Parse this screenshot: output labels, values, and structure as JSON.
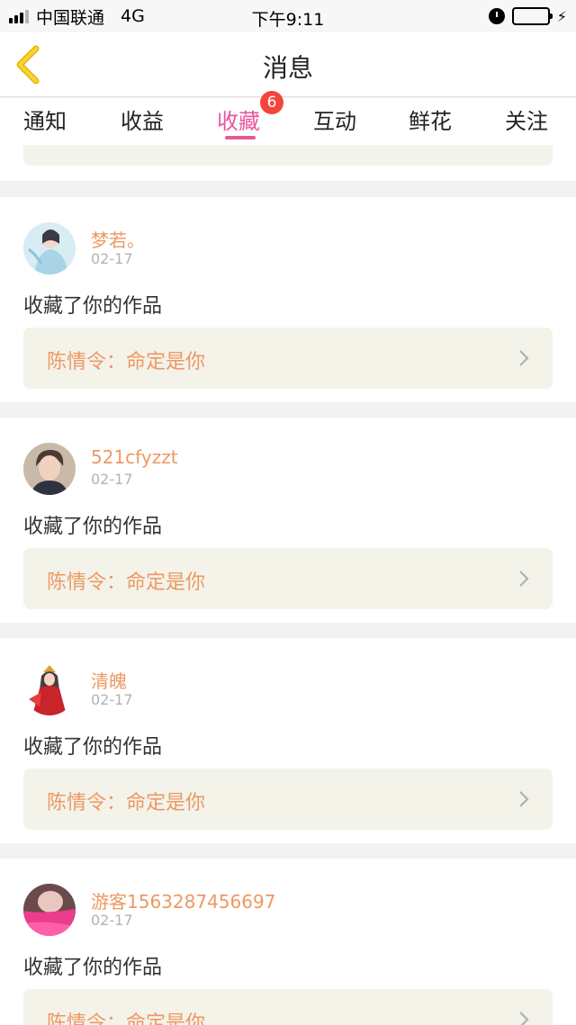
{
  "status_bar": {
    "carrier": "中国联通",
    "network": "4G",
    "time": "下午9:11",
    "icons": [
      "signal-icon",
      "alarm-icon",
      "battery-icon",
      "charging-icon"
    ],
    "battery_color": "#4cd964"
  },
  "nav": {
    "back_icon": "chevron-left-icon",
    "title": "消息",
    "accent": "#f0c419"
  },
  "tabs": {
    "items": [
      {
        "label": "通知"
      },
      {
        "label": "收益"
      },
      {
        "label": "收藏",
        "active": true,
        "badge": "6"
      },
      {
        "label": "互动"
      },
      {
        "label": "鲜花"
      },
      {
        "label": "关注"
      }
    ],
    "active_color": "#e8579a",
    "badge_color": "#f2453d"
  },
  "feed": [
    {
      "user": "梦若。",
      "date": "02-17",
      "action": "收藏了你的作品",
      "work": "陈情令：命定是你"
    },
    {
      "user": "521cfyzzt",
      "date": "02-17",
      "action": "收藏了你的作品",
      "work": "陈情令：命定是你"
    },
    {
      "user": "清魄",
      "date": "02-17",
      "action": "收藏了你的作品",
      "work": "陈情令：命定是你"
    },
    {
      "user": "游客1563287456697",
      "date": "02-17",
      "action": "收藏了你的作品",
      "work": "陈情令：命定是你"
    }
  ],
  "colors": {
    "username": "#ee9861",
    "work_box": "#f3f3ea"
  }
}
